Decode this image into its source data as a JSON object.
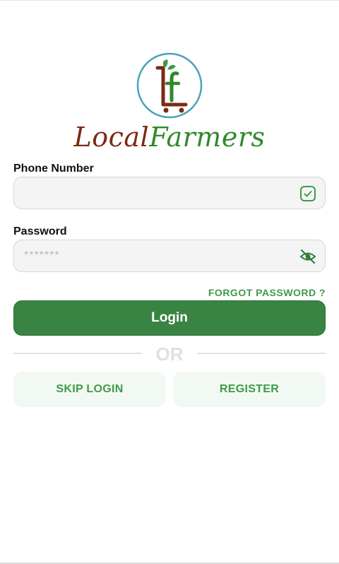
{
  "brand": {
    "part1": "Local",
    "part2": "Farmers",
    "logo_icon": "local-farmers-logo"
  },
  "form": {
    "phone_label": "Phone Number",
    "phone_value": "",
    "phone_icon": "check-square-icon",
    "password_label": "Password",
    "password_placeholder": "*******",
    "password_icon": "eye-off-icon",
    "forgot_label": "FORGOT PASSWORD ?",
    "login_label": "Login"
  },
  "divider": {
    "text": "OR"
  },
  "actions": {
    "skip_label": "SKIP LOGIN",
    "register_label": "REGISTER"
  },
  "colors": {
    "primary": "#3a8443",
    "accent": "#3f9a48",
    "brand_brown": "#7a2b12",
    "light_green_bg": "#f2f9f2"
  }
}
